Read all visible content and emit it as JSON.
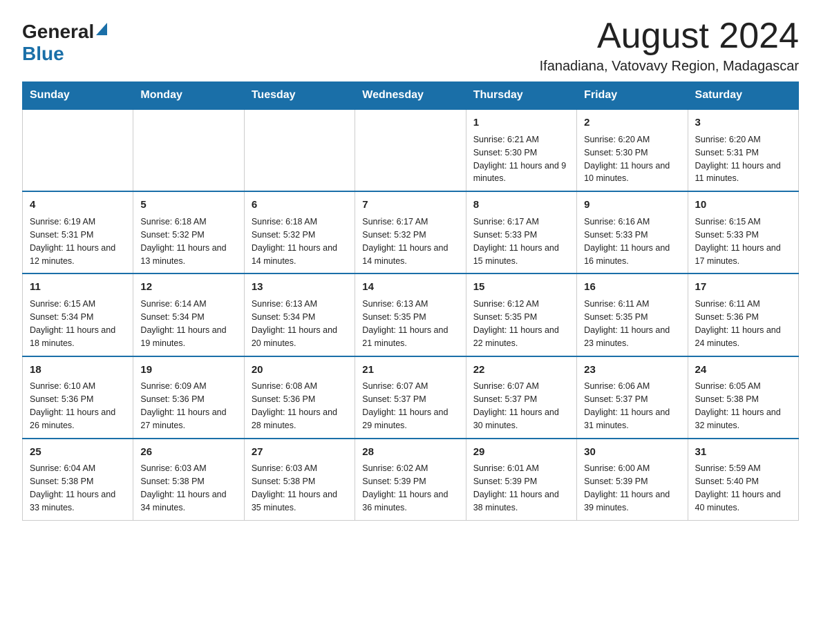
{
  "header": {
    "logo_general": "General",
    "logo_blue": "Blue",
    "month_title": "August 2024",
    "location": "Ifanadiana, Vatovavy Region, Madagascar"
  },
  "weekdays": [
    "Sunday",
    "Monday",
    "Tuesday",
    "Wednesday",
    "Thursday",
    "Friday",
    "Saturday"
  ],
  "weeks": [
    [
      {
        "day": "",
        "info": ""
      },
      {
        "day": "",
        "info": ""
      },
      {
        "day": "",
        "info": ""
      },
      {
        "day": "",
        "info": ""
      },
      {
        "day": "1",
        "info": "Sunrise: 6:21 AM\nSunset: 5:30 PM\nDaylight: 11 hours and 9 minutes."
      },
      {
        "day": "2",
        "info": "Sunrise: 6:20 AM\nSunset: 5:30 PM\nDaylight: 11 hours and 10 minutes."
      },
      {
        "day": "3",
        "info": "Sunrise: 6:20 AM\nSunset: 5:31 PM\nDaylight: 11 hours and 11 minutes."
      }
    ],
    [
      {
        "day": "4",
        "info": "Sunrise: 6:19 AM\nSunset: 5:31 PM\nDaylight: 11 hours and 12 minutes."
      },
      {
        "day": "5",
        "info": "Sunrise: 6:18 AM\nSunset: 5:32 PM\nDaylight: 11 hours and 13 minutes."
      },
      {
        "day": "6",
        "info": "Sunrise: 6:18 AM\nSunset: 5:32 PM\nDaylight: 11 hours and 14 minutes."
      },
      {
        "day": "7",
        "info": "Sunrise: 6:17 AM\nSunset: 5:32 PM\nDaylight: 11 hours and 14 minutes."
      },
      {
        "day": "8",
        "info": "Sunrise: 6:17 AM\nSunset: 5:33 PM\nDaylight: 11 hours and 15 minutes."
      },
      {
        "day": "9",
        "info": "Sunrise: 6:16 AM\nSunset: 5:33 PM\nDaylight: 11 hours and 16 minutes."
      },
      {
        "day": "10",
        "info": "Sunrise: 6:15 AM\nSunset: 5:33 PM\nDaylight: 11 hours and 17 minutes."
      }
    ],
    [
      {
        "day": "11",
        "info": "Sunrise: 6:15 AM\nSunset: 5:34 PM\nDaylight: 11 hours and 18 minutes."
      },
      {
        "day": "12",
        "info": "Sunrise: 6:14 AM\nSunset: 5:34 PM\nDaylight: 11 hours and 19 minutes."
      },
      {
        "day": "13",
        "info": "Sunrise: 6:13 AM\nSunset: 5:34 PM\nDaylight: 11 hours and 20 minutes."
      },
      {
        "day": "14",
        "info": "Sunrise: 6:13 AM\nSunset: 5:35 PM\nDaylight: 11 hours and 21 minutes."
      },
      {
        "day": "15",
        "info": "Sunrise: 6:12 AM\nSunset: 5:35 PM\nDaylight: 11 hours and 22 minutes."
      },
      {
        "day": "16",
        "info": "Sunrise: 6:11 AM\nSunset: 5:35 PM\nDaylight: 11 hours and 23 minutes."
      },
      {
        "day": "17",
        "info": "Sunrise: 6:11 AM\nSunset: 5:36 PM\nDaylight: 11 hours and 24 minutes."
      }
    ],
    [
      {
        "day": "18",
        "info": "Sunrise: 6:10 AM\nSunset: 5:36 PM\nDaylight: 11 hours and 26 minutes."
      },
      {
        "day": "19",
        "info": "Sunrise: 6:09 AM\nSunset: 5:36 PM\nDaylight: 11 hours and 27 minutes."
      },
      {
        "day": "20",
        "info": "Sunrise: 6:08 AM\nSunset: 5:36 PM\nDaylight: 11 hours and 28 minutes."
      },
      {
        "day": "21",
        "info": "Sunrise: 6:07 AM\nSunset: 5:37 PM\nDaylight: 11 hours and 29 minutes."
      },
      {
        "day": "22",
        "info": "Sunrise: 6:07 AM\nSunset: 5:37 PM\nDaylight: 11 hours and 30 minutes."
      },
      {
        "day": "23",
        "info": "Sunrise: 6:06 AM\nSunset: 5:37 PM\nDaylight: 11 hours and 31 minutes."
      },
      {
        "day": "24",
        "info": "Sunrise: 6:05 AM\nSunset: 5:38 PM\nDaylight: 11 hours and 32 minutes."
      }
    ],
    [
      {
        "day": "25",
        "info": "Sunrise: 6:04 AM\nSunset: 5:38 PM\nDaylight: 11 hours and 33 minutes."
      },
      {
        "day": "26",
        "info": "Sunrise: 6:03 AM\nSunset: 5:38 PM\nDaylight: 11 hours and 34 minutes."
      },
      {
        "day": "27",
        "info": "Sunrise: 6:03 AM\nSunset: 5:38 PM\nDaylight: 11 hours and 35 minutes."
      },
      {
        "day": "28",
        "info": "Sunrise: 6:02 AM\nSunset: 5:39 PM\nDaylight: 11 hours and 36 minutes."
      },
      {
        "day": "29",
        "info": "Sunrise: 6:01 AM\nSunset: 5:39 PM\nDaylight: 11 hours and 38 minutes."
      },
      {
        "day": "30",
        "info": "Sunrise: 6:00 AM\nSunset: 5:39 PM\nDaylight: 11 hours and 39 minutes."
      },
      {
        "day": "31",
        "info": "Sunrise: 5:59 AM\nSunset: 5:40 PM\nDaylight: 11 hours and 40 minutes."
      }
    ]
  ]
}
